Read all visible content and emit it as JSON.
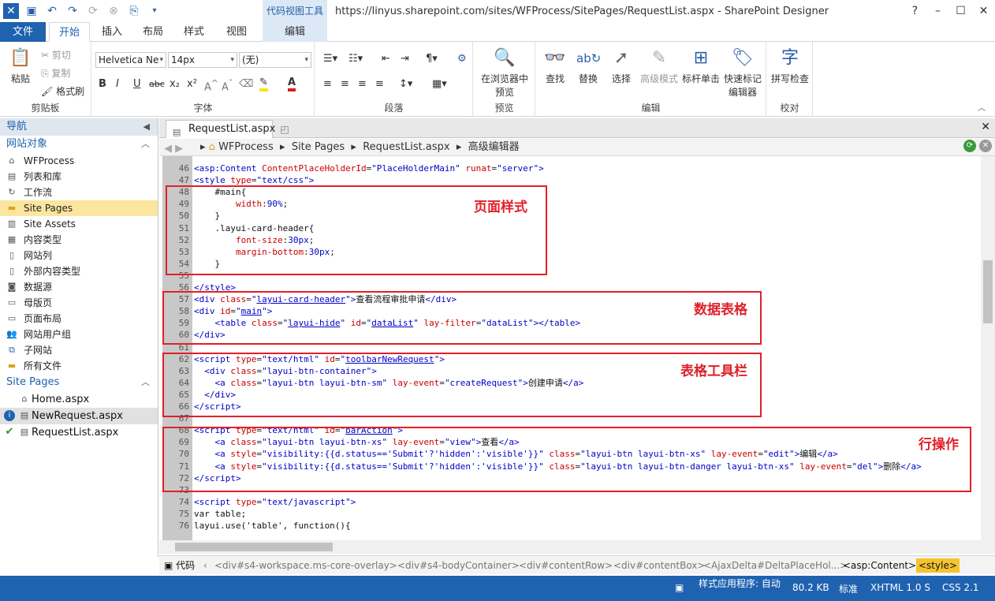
{
  "title_bar": {
    "title": "https://linyus.sharepoint.com/sites/WFProcess/SitePages/RequestList.aspx - SharePoint Designer",
    "context_tab_group": "代码视图工具",
    "help": "?"
  },
  "ribbon_tabs": [
    "文件",
    "开始",
    "插入",
    "布局",
    "样式",
    "视图",
    "编辑"
  ],
  "clipboard": {
    "paste": "粘贴",
    "cut": "剪切",
    "copy": "复制",
    "format_painter": "格式刷",
    "label": "剪贴板"
  },
  "font": {
    "family": "Helvetica Ne",
    "size": "14px",
    "style": "(无)",
    "label": "字体",
    "bold": "B",
    "italic": "I",
    "underline": "U",
    "strike": "abc",
    "sub": "x₂",
    "sup": "x²"
  },
  "paragraph": {
    "label": "段落"
  },
  "preview": {
    "button": "在浏览器中预览",
    "label": "预览"
  },
  "editing": {
    "find": "查找",
    "replace": "替换",
    "select": "选择",
    "advanced_mode": "高级模式",
    "skewer_click": "标杆单击",
    "quick_tag_editor": "快速标记编辑器",
    "label": "编辑"
  },
  "proofing": {
    "spell_check": "拼写检查",
    "label": "校对"
  },
  "nav": {
    "header": "导航",
    "section_site_objects": "网站对象",
    "items": [
      "WFProcess",
      "列表和库",
      "工作流",
      "Site Pages",
      "Site Assets",
      "内容类型",
      "网站列",
      "外部内容类型",
      "数据源",
      "母版页",
      "页面布局",
      "网站用户组",
      "子网站",
      "所有文件"
    ],
    "section_site_pages": "Site Pages",
    "files": [
      "Home.aspx",
      "NewRequest.aspx",
      "RequestList.aspx"
    ]
  },
  "doc_tab": {
    "label": "RequestList.aspx"
  },
  "breadcrumb": [
    "WFProcess",
    "Site Pages",
    "RequestList.aspx",
    "高级编辑器"
  ],
  "code_lines": [
    {
      "n": "46",
      "h": "<span class='tg'>&lt;asp:Content</span> <span class='at'>ContentPlaceHolderId</span>=<span class='vl'>\"PlaceHolderMain\"</span> <span class='at'>runat</span>=<span class='vl'>\"server\"</span><span class='tg'>&gt;</span>"
    },
    {
      "n": "47",
      "h": "<span class='tg'>&lt;style</span> <span class='at'>type</span>=<span class='vl'>\"text/css\"</span><span class='tg'>&gt;</span>"
    },
    {
      "n": "48",
      "h": "    <span class='tx'>#main{</span>"
    },
    {
      "n": "49",
      "h": "        <span class='at'>width</span>:<span class='vl'>90%</span>;"
    },
    {
      "n": "50",
      "h": "    <span class='tx'>}</span>"
    },
    {
      "n": "51",
      "h": "    <span class='tx'>.layui-card-header{</span>"
    },
    {
      "n": "52",
      "h": "        <span class='at'>font-size</span>:<span class='vl'>30px</span>;"
    },
    {
      "n": "53",
      "h": "        <span class='at'>margin-bottom</span>:<span class='vl'>30px</span>;"
    },
    {
      "n": "54",
      "h": "    <span class='tx'>}</span>"
    },
    {
      "n": "55",
      "h": ""
    },
    {
      "n": "56",
      "h": "<span class='tg'>&lt;/style&gt;</span>"
    },
    {
      "n": "57",
      "h": "<span class='tg'>&lt;div</span> <span class='at'>class</span>=<span class='vl'>\"<span class='ul'>layui-card-header</span>\"</span><span class='tg'>&gt;</span><span class='tx'>查看流程审批申请</span><span class='tg'>&lt;/div&gt;</span>"
    },
    {
      "n": "58",
      "h": "<span class='tg'>&lt;div</span> <span class='at'>id</span>=<span class='vl'>\"<span class='ul'>main</span>\"</span><span class='tg'>&gt;</span>"
    },
    {
      "n": "59",
      "h": "    <span class='tg'>&lt;table</span> <span class='at'>class</span>=<span class='vl'>\"<span class='ul'>layui-hide</span>\"</span> <span class='at'>id</span>=<span class='vl'>\"<span class='ul'>dataList</span>\"</span> <span class='at'>lay-filter</span>=<span class='vl'>\"dataList\"</span><span class='tg'>&gt;&lt;/table&gt;</span>"
    },
    {
      "n": "60",
      "h": "<span class='tg'>&lt;/div&gt;</span>"
    },
    {
      "n": "61",
      "h": ""
    },
    {
      "n": "62",
      "h": "<span class='tg'>&lt;script</span> <span class='at'>type</span>=<span class='vl'>\"text/html\"</span> <span class='at'>id</span>=<span class='vl'>\"<span class='ul'>toolbarNewRequest</span>\"</span><span class='tg'>&gt;</span>"
    },
    {
      "n": "63",
      "h": "  <span class='tg'>&lt;div</span> <span class='at'>class</span>=<span class='vl'>\"layui-btn-container\"</span><span class='tg'>&gt;</span>"
    },
    {
      "n": "64",
      "h": "    <span class='tg'>&lt;a</span> <span class='at'>class</span>=<span class='vl'>\"layui-btn layui-btn-sm\"</span> <span class='at'>lay-event</span>=<span class='vl'>\"createRequest\"</span><span class='tg'>&gt;</span><span class='tx'>创建申请</span><span class='tg'>&lt;/a&gt;</span>"
    },
    {
      "n": "65",
      "h": "  <span class='tg'>&lt;/div&gt;</span>"
    },
    {
      "n": "66",
      "h": "<span class='tg'>&lt;/script&gt;</span>"
    },
    {
      "n": "67",
      "h": ""
    },
    {
      "n": "68",
      "h": "<span class='tg'>&lt;script</span> <span class='at'>type</span>=<span class='vl'>\"text/html\"</span> <span class='at'>id</span>=<span class='vl'>\"<span class='ul'>barAction</span>\"</span><span class='tg'>&gt;</span>"
    },
    {
      "n": "69",
      "h": "    <span class='tg'>&lt;a</span> <span class='at'>class</span>=<span class='vl'>\"layui-btn layui-btn-xs\"</span> <span class='at'>lay-event</span>=<span class='vl'>\"view\"</span><span class='tg'>&gt;</span><span class='tx'>查看</span><span class='tg'>&lt;/a&gt;</span>"
    },
    {
      "n": "70",
      "h": "    <span class='tg'>&lt;a</span> <span class='at'>style</span>=<span class='vl'>\"visibility:{{d.status=='Submit'?'hidden':'visible'}}\"</span> <span class='at'>class</span>=<span class='vl'>\"layui-btn layui-btn-xs\"</span> <span class='at'>lay-event</span>=<span class='vl'>\"edit\"</span><span class='tg'>&gt;</span><span class='tx'>编辑</span><span class='tg'>&lt;/a&gt;</span>"
    },
    {
      "n": "71",
      "h": "    <span class='tg'>&lt;a</span> <span class='at'>style</span>=<span class='vl'>\"visibility:{{d.status=='Submit'?'hidden':'visible'}}\"</span> <span class='at'>class</span>=<span class='vl'>\"layui-btn layui-btn-danger layui-btn-xs\"</span> <span class='at'>lay-event</span>=<span class='vl'>\"del\"</span><span class='tg'>&gt;</span><span class='tx'>删除</span><span class='tg'>&lt;/a&gt;</span>"
    },
    {
      "n": "72",
      "h": "<span class='tg'>&lt;/script&gt;</span>"
    },
    {
      "n": "73",
      "h": ""
    },
    {
      "n": "74",
      "h": "<span class='tg'>&lt;script</span> <span class='at'>type</span>=<span class='vl'>\"text/javascript\"</span><span class='tg'>&gt;</span>"
    },
    {
      "n": "75",
      "h": "<span class='tx'>var table;</span>"
    },
    {
      "n": "76",
      "h": "<span class='tx'>layui.use('table', function(){</span>"
    }
  ],
  "annotations": {
    "style": "页面样式",
    "table": "数据表格",
    "toolbar": "表格工具栏",
    "row_action": "行操作"
  },
  "tag_bar": {
    "code": "代码",
    "tags": [
      "<div#s4-workspace.ms-core-overlay>",
      "<div#s4-bodyContainer>",
      "<div#contentRow>",
      "<div#contentBox>",
      "<AjaxDelta#DeltaPlaceHol...>",
      "<asp:Content>",
      "<style>"
    ]
  },
  "status": {
    "style_app": "样式应用程序: 自动",
    "size": "80.2 KB",
    "mode": "标准",
    "doctype": "XHTML 1.0 S",
    "css": "CSS 2.1"
  }
}
